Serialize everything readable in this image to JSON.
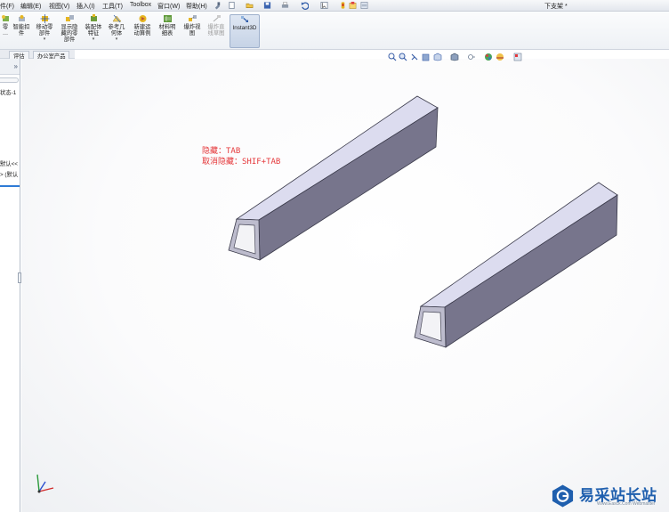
{
  "menubar": {
    "items": [
      {
        "label": "件(F)"
      },
      {
        "label": "编辑(E)"
      },
      {
        "label": "视图(V)"
      },
      {
        "label": "插入(I)"
      },
      {
        "label": "工具(T)"
      },
      {
        "label": "Toolbox"
      },
      {
        "label": "窗口(W)"
      },
      {
        "label": "帮助(H)"
      }
    ],
    "document_title": "下支架 *"
  },
  "commands": [
    {
      "label": "零\n…"
    },
    {
      "label": "智能扣\n件"
    },
    {
      "label": "移动零\n部件"
    },
    {
      "label": "显示隐\n藏的零\n部件"
    },
    {
      "label": "装配体\n特征"
    },
    {
      "label": "参考几\n何体"
    },
    {
      "label": "新建运\n动算例"
    },
    {
      "label": "材料明\n细表"
    },
    {
      "label": "爆炸视\n图"
    },
    {
      "label": "爆炸直\n线草图"
    },
    {
      "label": "Instant3D"
    }
  ],
  "tabs": [
    {
      "label": "评估"
    },
    {
      "label": "办公室产品"
    }
  ],
  "feature_tree": {
    "collapse": "»",
    "config_text": "状态-1",
    "row1": "默认<<",
    "row2": "> (默认"
  },
  "notes": {
    "hide": "隐藏：TAB",
    "unhide": "取消隐藏：SHIF+TAB"
  },
  "watermark": {
    "name": "易采站长站",
    "sub": "Www.Easck.Com  Webmaster"
  },
  "colors": {
    "tube_top": "#dcdcef",
    "tube_side": "#77758c",
    "tube_end": "#bdbccd",
    "note": "#e5383b",
    "watermark": "#1f5fae"
  }
}
